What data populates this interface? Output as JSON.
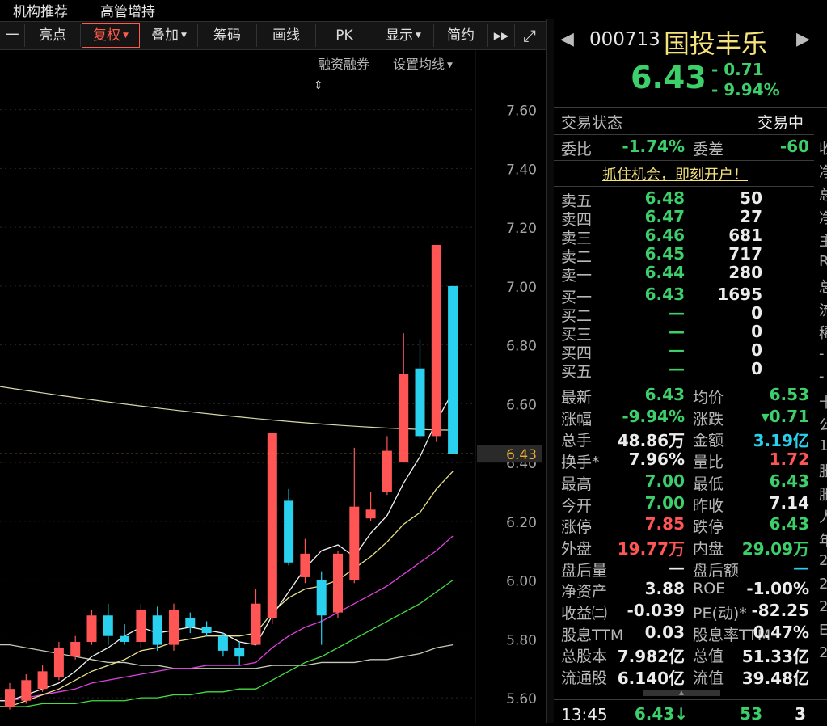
{
  "top_nav": [
    "机构推荐",
    "高管增持"
  ],
  "toolbar": {
    "dash": "一",
    "items": [
      "亮点",
      "复权",
      "叠加",
      "筹码",
      "画线",
      "PK",
      "显示",
      "简约"
    ],
    "ff_glyph": "▶▶",
    "expand_glyph": "⤢"
  },
  "sublinks": {
    "margin": "融资融券",
    "ma_setting": "设置均线"
  },
  "chart_data": {
    "type": "candlestick",
    "y_ticks": [
      "7.60",
      "7.40",
      "7.20",
      "7.00",
      "6.80",
      "6.60",
      "6.40",
      "6.20",
      "6.00",
      "5.80",
      "5.60"
    ],
    "ylim": [
      5.57,
      7.72
    ],
    "current_price_label": "6.43",
    "current_price": 6.43,
    "long_ma_level": 6.51,
    "candles": [
      {
        "o": 5.57,
        "c": 5.63,
        "h": 5.65,
        "l": 5.56
      },
      {
        "o": 5.59,
        "c": 5.66,
        "h": 5.68,
        "l": 5.58
      },
      {
        "o": 5.63,
        "c": 5.69,
        "h": 5.71,
        "l": 5.62
      },
      {
        "o": 5.67,
        "c": 5.77,
        "h": 5.79,
        "l": 5.66
      },
      {
        "o": 5.74,
        "c": 5.79,
        "h": 5.81,
        "l": 5.73
      },
      {
        "o": 5.79,
        "c": 5.88,
        "h": 5.9,
        "l": 5.78
      },
      {
        "o": 5.88,
        "c": 5.81,
        "h": 5.92,
        "l": 5.78
      },
      {
        "o": 5.81,
        "c": 5.79,
        "h": 5.85,
        "l": 5.78
      },
      {
        "o": 5.79,
        "c": 5.9,
        "h": 5.92,
        "l": 5.77
      },
      {
        "o": 5.88,
        "c": 5.78,
        "h": 5.91,
        "l": 5.76
      },
      {
        "o": 5.78,
        "c": 5.9,
        "h": 5.92,
        "l": 5.76
      },
      {
        "o": 5.87,
        "c": 5.84,
        "h": 5.89,
        "l": 5.82
      },
      {
        "o": 5.84,
        "c": 5.82,
        "h": 5.86,
        "l": 5.81
      },
      {
        "o": 5.81,
        "c": 5.76,
        "h": 5.82,
        "l": 5.74
      },
      {
        "o": 5.77,
        "c": 5.74,
        "h": 5.79,
        "l": 5.71
      },
      {
        "o": 5.78,
        "c": 5.92,
        "h": 5.97,
        "l": 5.78
      },
      {
        "o": 5.87,
        "c": 6.5,
        "h": 6.5,
        "l": 5.85
      },
      {
        "o": 6.27,
        "c": 6.06,
        "h": 6.31,
        "l": 6.05
      },
      {
        "o": 6.01,
        "c": 6.09,
        "h": 6.14,
        "l": 5.99
      },
      {
        "o": 6.0,
        "c": 5.88,
        "h": 6.03,
        "l": 5.78
      },
      {
        "o": 5.89,
        "c": 6.09,
        "h": 6.1,
        "l": 5.87
      },
      {
        "o": 6.0,
        "c": 6.25,
        "h": 6.45,
        "l": 5.99
      },
      {
        "o": 6.21,
        "c": 6.24,
        "h": 6.3,
        "l": 6.2
      },
      {
        "o": 6.3,
        "c": 6.44,
        "h": 6.49,
        "l": 6.29
      },
      {
        "o": 6.4,
        "c": 6.7,
        "h": 6.84,
        "l": 6.4
      },
      {
        "o": 6.72,
        "c": 6.49,
        "h": 6.82,
        "l": 6.48
      },
      {
        "o": 6.49,
        "c": 7.14,
        "h": 7.14,
        "l": 6.47
      },
      {
        "o": 7.0,
        "c": 6.43,
        "h": 7.0,
        "l": 6.43
      }
    ],
    "ma_long": [
      5.78,
      5.77,
      5.76,
      5.75,
      5.74,
      5.73,
      5.72,
      5.72,
      5.71,
      5.71,
      5.7,
      5.7,
      5.7,
      5.7,
      5.7,
      5.7,
      5.71,
      5.71,
      5.71,
      5.72,
      5.72,
      5.72,
      5.73,
      5.73,
      5.74,
      5.75,
      5.77,
      5.78
    ],
    "ma_60": [
      5.57,
      5.57,
      5.58,
      5.58,
      5.58,
      5.59,
      5.59,
      5.59,
      5.6,
      5.6,
      5.61,
      5.61,
      5.62,
      5.62,
      5.63,
      5.63,
      5.66,
      5.69,
      5.72,
      5.74,
      5.77,
      5.8,
      5.83,
      5.86,
      5.89,
      5.92,
      5.96,
      6.0
    ],
    "ma_30": [
      5.59,
      5.6,
      5.61,
      5.62,
      5.63,
      5.65,
      5.66,
      5.67,
      5.68,
      5.69,
      5.7,
      5.7,
      5.71,
      5.71,
      5.71,
      5.72,
      5.77,
      5.81,
      5.84,
      5.86,
      5.89,
      5.92,
      5.95,
      5.98,
      6.02,
      6.06,
      6.1,
      6.15
    ],
    "ma_10": [
      5.57,
      5.59,
      5.61,
      5.63,
      5.66,
      5.69,
      5.71,
      5.73,
      5.76,
      5.77,
      5.79,
      5.8,
      5.81,
      5.81,
      5.81,
      5.82,
      5.89,
      5.94,
      5.97,
      5.98,
      6.0,
      6.04,
      6.08,
      6.13,
      6.19,
      6.23,
      6.31,
      6.37
    ],
    "ma_5": [
      5.59,
      5.61,
      5.63,
      5.65,
      5.69,
      5.74,
      5.77,
      5.81,
      5.84,
      5.82,
      5.83,
      5.84,
      5.83,
      5.82,
      5.79,
      5.78,
      5.88,
      5.96,
      6.04,
      6.1,
      6.12,
      6.08,
      6.16,
      6.22,
      6.33,
      6.42,
      6.54,
      6.64
    ]
  },
  "quote": {
    "code": "000713",
    "name": "国投丰乐",
    "price": "6.43",
    "change": "- 0.71",
    "change_pct": "- 9.94%",
    "trade_status_label": "交易状态",
    "trade_status": "交易中",
    "weibi_label": "委比",
    "weibi": "-1.74%",
    "weicha_label": "委差",
    "weicha": "-60",
    "open_account": "抓住机会，即刻开户！"
  },
  "order_book": {
    "asks": [
      {
        "label": "卖五",
        "price": "6.48",
        "vol": "50"
      },
      {
        "label": "卖四",
        "price": "6.47",
        "vol": "27"
      },
      {
        "label": "卖三",
        "price": "6.46",
        "vol": "681"
      },
      {
        "label": "卖二",
        "price": "6.45",
        "vol": "717"
      },
      {
        "label": "卖一",
        "price": "6.44",
        "vol": "280"
      }
    ],
    "bids": [
      {
        "label": "买一",
        "price": "6.43",
        "vol": "1695"
      },
      {
        "label": "买二",
        "price": "—",
        "vol": "0"
      },
      {
        "label": "买三",
        "price": "—",
        "vol": "0"
      },
      {
        "label": "买四",
        "price": "—",
        "vol": "0"
      },
      {
        "label": "买五",
        "price": "—",
        "vol": "0"
      }
    ]
  },
  "stats": {
    "rows": [
      [
        {
          "l": "最新",
          "v": "6.43",
          "c": "g"
        },
        {
          "l": "均价",
          "v": "6.53",
          "c": "g"
        }
      ],
      [
        {
          "l": "涨幅",
          "v": "-9.94%",
          "c": "g"
        },
        {
          "l": "涨跌",
          "v": "▾0.71",
          "c": "g"
        }
      ],
      [
        {
          "l": "总手",
          "v": "48.86万",
          "c": "w"
        },
        {
          "l": "金额",
          "v": "3.19亿",
          "c": "c"
        }
      ],
      [
        {
          "l": "换手*",
          "v": "7.96%",
          "c": "w"
        },
        {
          "l": "量比",
          "v": "1.72",
          "c": "r"
        }
      ],
      [
        {
          "l": "最高",
          "v": "7.00",
          "c": "g"
        },
        {
          "l": "最低",
          "v": "6.43",
          "c": "g"
        }
      ],
      [
        {
          "l": "今开",
          "v": "7.00",
          "c": "g"
        },
        {
          "l": "昨收",
          "v": "7.14",
          "c": "w"
        }
      ],
      [
        {
          "l": "涨停",
          "v": "7.85",
          "c": "r"
        },
        {
          "l": "跌停",
          "v": "6.43",
          "c": "g"
        }
      ],
      [
        {
          "l": "外盘",
          "v": "19.77万",
          "c": "r"
        },
        {
          "l": "内盘",
          "v": "29.09万",
          "c": "g"
        }
      ],
      [
        {
          "l": "盘后量",
          "v": "—",
          "c": "w"
        },
        {
          "l": "盘后额",
          "v": "—",
          "c": "c"
        }
      ],
      [
        {
          "l": "净资产",
          "v": "3.88",
          "c": "w"
        },
        {
          "l": "ROE",
          "v": "-1.00%",
          "c": "w"
        }
      ],
      [
        {
          "l": "收益㈡",
          "v": "-0.039",
          "c": "w"
        },
        {
          "l": "PE(动)*",
          "v": "-82.25",
          "c": "w"
        }
      ],
      [
        {
          "l": "股息TTM",
          "v": "0.03",
          "c": "w"
        },
        {
          "l": "股息率TTM",
          "v": "0.47%",
          "c": "w"
        }
      ],
      [
        {
          "l": "总股本",
          "v": "7.982亿",
          "c": "w"
        },
        {
          "l": "总值",
          "v": "51.33亿",
          "c": "w"
        }
      ],
      [
        {
          "l": "流通股",
          "v": "6.140亿",
          "c": "w"
        },
        {
          "l": "流值",
          "v": "39.48亿",
          "c": "w"
        }
      ]
    ]
  },
  "tick": {
    "time": "13:45",
    "price": "6.43",
    "arrow": "↓",
    "vol": "53",
    "count": "3"
  },
  "edge_text": [
    "收",
    "净",
    "总",
    "净",
    "主",
    "R",
    "总",
    "流",
    "稀",
    "-",
    "-",
    "十",
    "公",
    "1",
    "胀",
    "胀",
    "人",
    "年",
    "2",
    "2",
    "2",
    "E",
    "2"
  ],
  "colors": {
    "up": "#ff5555",
    "down": "#2ad1ef",
    "green": "#3dcf6a",
    "yellow": "#f5e27a",
    "magenta": "#e040e0",
    "ma10": "#e8e08a",
    "ma_long": "#c8c8b8"
  }
}
